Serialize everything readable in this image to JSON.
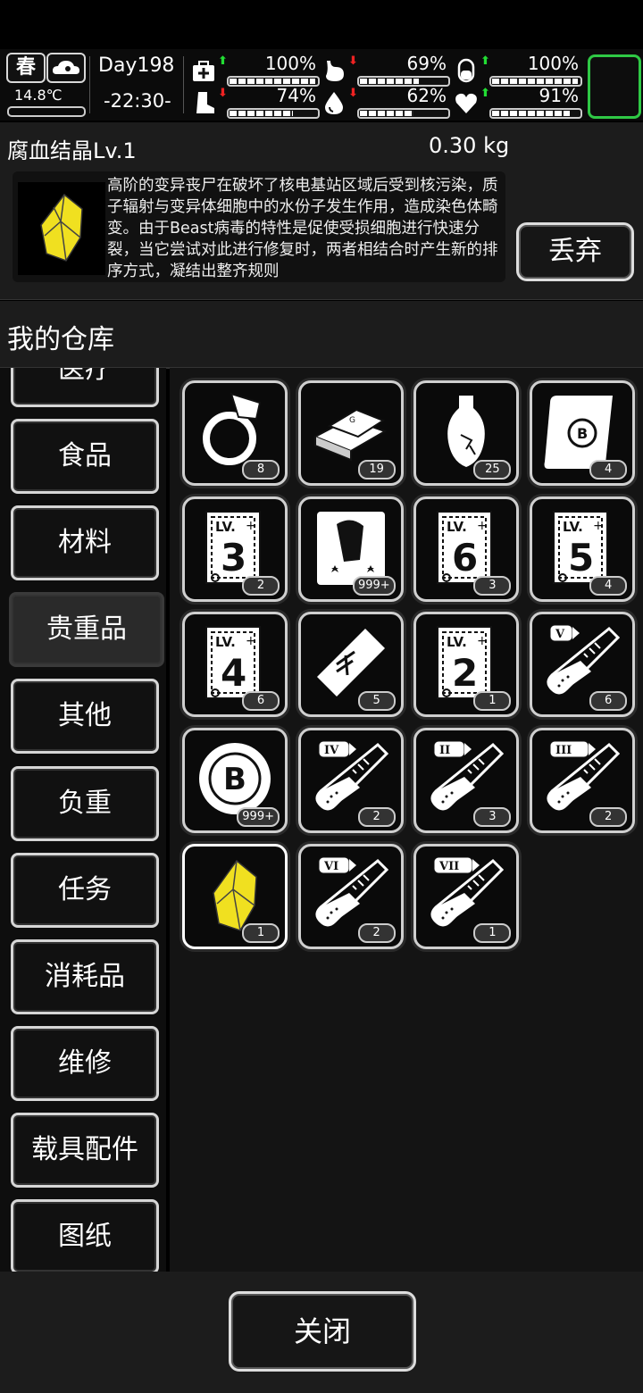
{
  "status": {
    "season": "春",
    "temperature": "14.8℃",
    "day": "Day198",
    "time": "-22:30-",
    "stats": [
      {
        "name": "health",
        "icon": "medkit-icon",
        "value": "100%",
        "trend": "up",
        "level": 1.0
      },
      {
        "name": "hunger",
        "icon": "stomach-icon",
        "value": "69%",
        "trend": "down",
        "level": 0.69
      },
      {
        "name": "energy",
        "icon": "pill-icon",
        "value": "100%",
        "trend": "up",
        "level": 1.0
      },
      {
        "name": "stamina",
        "icon": "boot-icon",
        "value": "74%",
        "trend": "down",
        "level": 0.74
      },
      {
        "name": "thirst",
        "icon": "water-drop-icon",
        "value": "62%",
        "trend": "down",
        "level": 0.62
      },
      {
        "name": "mood",
        "icon": "heart-icon",
        "value": "91%",
        "trend": "up",
        "level": 0.91
      }
    ],
    "colors": {
      "up": "#22dd33",
      "down": "#ee2222",
      "avatar_border": "#2fc845"
    }
  },
  "item": {
    "name": "腐血结晶Lv.1",
    "weight": "0.30 kg",
    "description": "高阶的变异丧尸在破坏了核电基站区域后受到核污染，质子辐射与变异体细胞中的水份子发生作用，造成染色体畸变。由于Beast病毒的特性是促使受损细胞进行快速分裂，当它尝试对此进行修复时，两者相结合时产生新的排序方式，凝结出整齐规则",
    "discard_label": "丢弃"
  },
  "warehouse": {
    "title": "我的仓库",
    "categories": [
      "医疗",
      "食品",
      "材料",
      "贵重品",
      "其他",
      "负重",
      "任务",
      "消耗品",
      "维修",
      "载具配件",
      "图纸"
    ],
    "active_category": "贵重品",
    "items": [
      {
        "icon": "ring-icon",
        "count": "8"
      },
      {
        "icon": "gold-bars-icon",
        "count": "19"
      },
      {
        "icon": "vase-icon",
        "count": "25"
      },
      {
        "icon": "scroll-map-icon",
        "count": "4"
      },
      {
        "icon": "skill-book-lv3-icon",
        "level": "3",
        "count": "2"
      },
      {
        "icon": "zombie-card-icon",
        "count": "999+"
      },
      {
        "icon": "skill-book-lv6-icon",
        "level": "6",
        "count": "3"
      },
      {
        "icon": "skill-book-lv5-icon",
        "level": "5",
        "count": "4"
      },
      {
        "icon": "skill-book-lv4-icon",
        "level": "4",
        "count": "6"
      },
      {
        "icon": "helicopter-ticket-icon",
        "count": "5"
      },
      {
        "icon": "skill-book-lv2-icon",
        "level": "2",
        "count": "1"
      },
      {
        "icon": "test-tube-v-icon",
        "tag": "V",
        "count": "6"
      },
      {
        "icon": "bitcoin-chip-icon",
        "count": "999+"
      },
      {
        "icon": "test-tube-iv-icon",
        "tag": "IV",
        "count": "2"
      },
      {
        "icon": "test-tube-ii-icon",
        "tag": "II",
        "count": "3"
      },
      {
        "icon": "test-tube-iii-icon",
        "tag": "III",
        "count": "2"
      },
      {
        "icon": "blood-crystal-icon",
        "count": "1",
        "selected": true
      },
      {
        "icon": "test-tube-vi-icon",
        "tag": "VI",
        "count": "2"
      },
      {
        "icon": "test-tube-vii-icon",
        "tag": "VII",
        "count": "1"
      }
    ],
    "crystal_color": "#f0e020"
  },
  "footer": {
    "close_label": "关闭"
  }
}
